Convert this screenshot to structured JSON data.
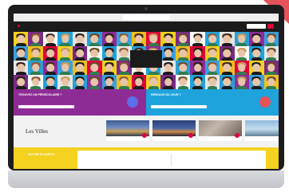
{
  "colors": {
    "purple": "#8e2c96",
    "blue": "#1fa3dc",
    "yellow": "#f4d21f",
    "accent_red": "#e2003b",
    "dark": "#1b1b1b"
  },
  "browser": {
    "url": ""
  },
  "nav": {
    "logo": "",
    "links": [
      "",
      "",
      "",
      ""
    ],
    "search_icon": "search-icon"
  },
  "hero": {
    "center_logo_line1": "",
    "center_logo_line2": ""
  },
  "promo": {
    "left_title": "TROUVEZ UN PÉRISCOLAIRE ?",
    "left_button": "",
    "right_title": "RÉSEAUX DU JOUR ?",
    "right_button": ""
  },
  "cities": {
    "kicker": "",
    "title": "Les Villes",
    "cards": [
      {
        "caption": ""
      },
      {
        "caption": ""
      },
      {
        "caption": ""
      },
      {
        "caption": ""
      }
    ]
  },
  "bottom": {
    "title": "NOTRE PLANÈTE",
    "col_left": "",
    "col_right": ""
  }
}
